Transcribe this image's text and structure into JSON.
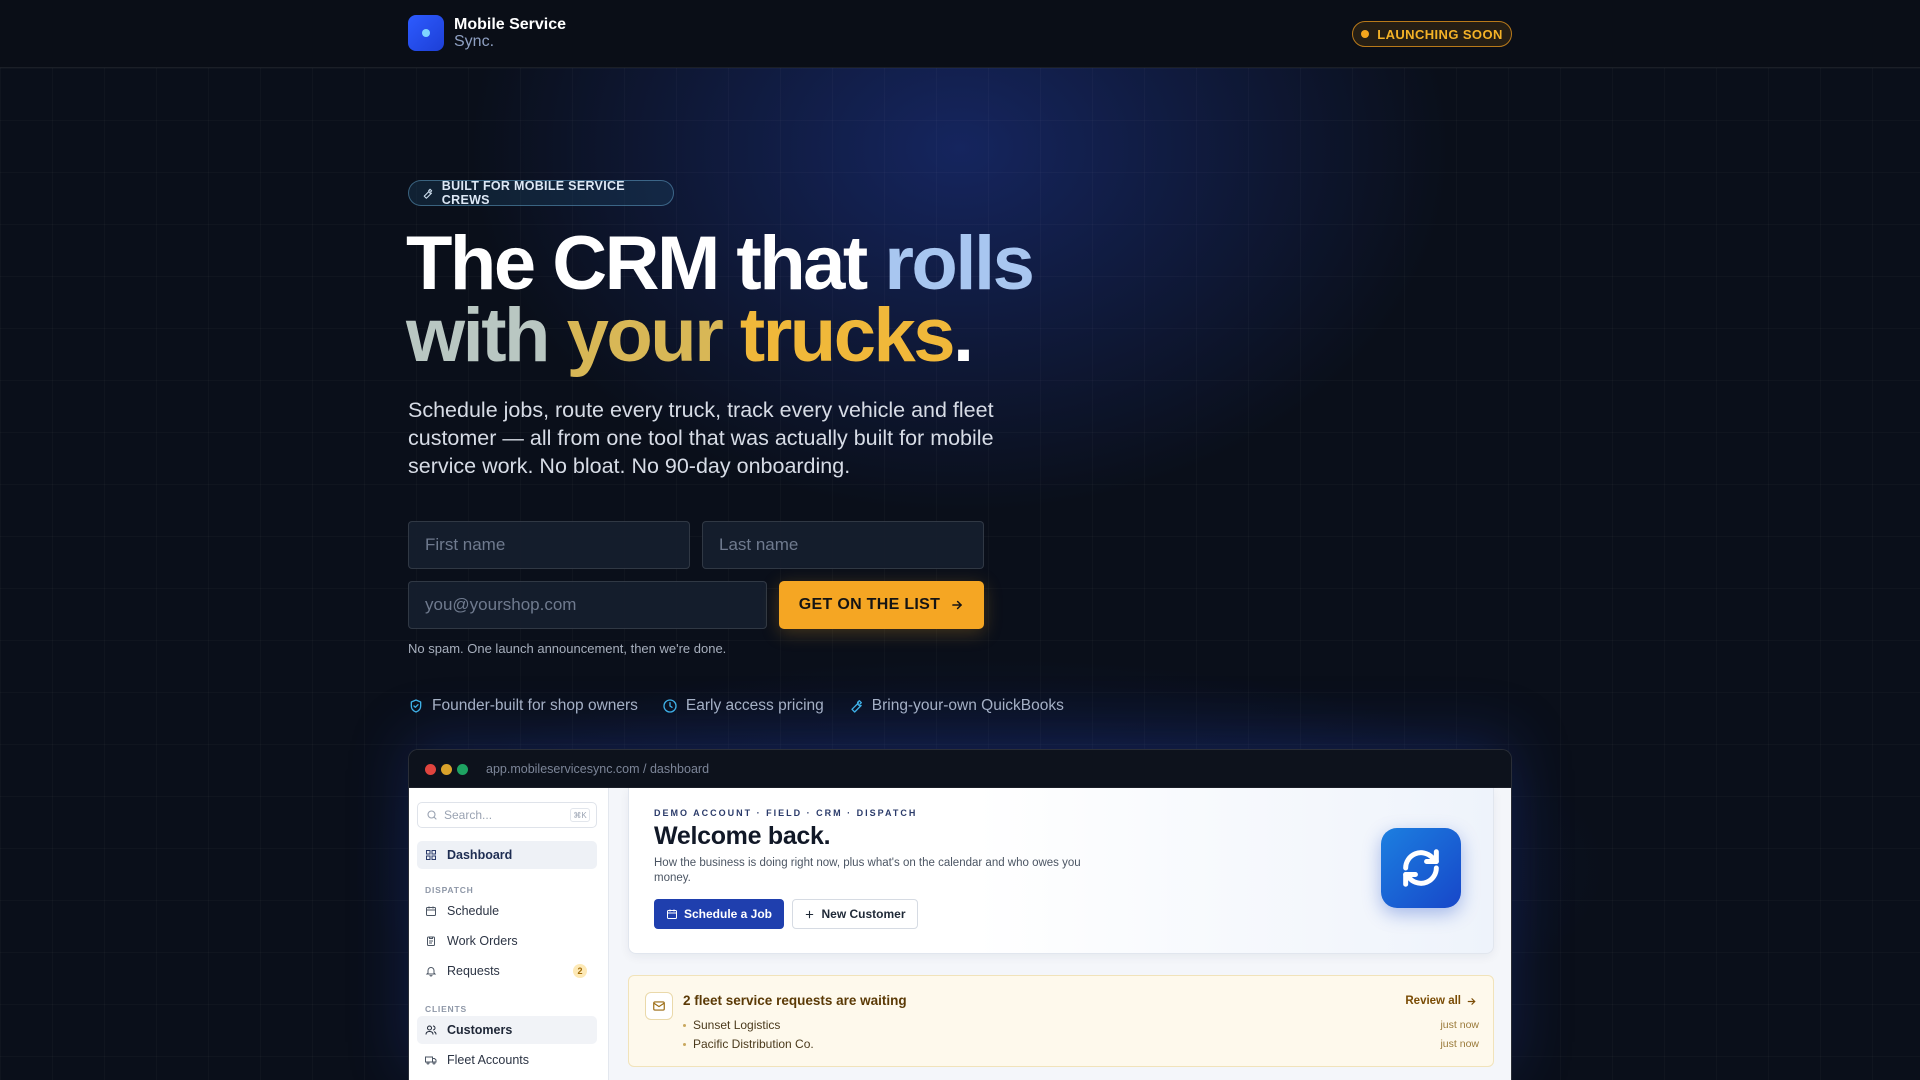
{
  "header": {
    "brand_name": "Mobile Service",
    "brand_sub": "Sync.",
    "launch_badge": "LAUNCHING SOON"
  },
  "hero": {
    "pill": "BUILT FOR MOBILE SERVICE CREWS",
    "headline": {
      "part1": "The CRM that ",
      "part2": "rolls",
      "part3": "with ",
      "part4": "your ",
      "part5": "trucks",
      "part6": "."
    },
    "subcopy": "Schedule jobs, route every truck, track every vehicle and fleet customer — all from one tool that was actually built for mobile service work. No bloat. No 90-day onboarding.",
    "form": {
      "first_name_placeholder": "First name",
      "last_name_placeholder": "Last name",
      "email_placeholder": "you@yourshop.com",
      "cta_label": "GET ON THE LIST",
      "disclaimer": "No spam. One launch announcement, then we're done."
    },
    "features": [
      {
        "label": "Founder-built for shop owners",
        "icon": "shield-check-icon"
      },
      {
        "label": "Early access pricing",
        "icon": "clock-icon"
      },
      {
        "label": "Bring-your-own QuickBooks",
        "icon": "wrench-icon"
      }
    ]
  },
  "preview": {
    "url": "app.mobileservicesync.com / dashboard",
    "traffic_lights": [
      "#e0443e",
      "#d9a22b",
      "#1ea362"
    ],
    "sidebar": {
      "search_placeholder": "Search...",
      "search_shortcut": "⌘K",
      "dashboard": "Dashboard",
      "section_dispatch": "DISPATCH",
      "schedule": "Schedule",
      "work_orders": "Work Orders",
      "requests": "Requests",
      "requests_count": "2",
      "section_clients": "CLIENTS",
      "customers": "Customers",
      "fleet_accounts": "Fleet Accounts"
    },
    "welcome": {
      "label": "DEMO ACCOUNT · FIELD · CRM · DISPATCH",
      "title": "Welcome back.",
      "subtitle": "How the business is doing right now, plus what's on the calendar and who owes you money.",
      "primary_button": "Schedule a Job",
      "secondary_button": "New Customer"
    },
    "alert": {
      "title": "2 fleet service requests are waiting",
      "review": "Review all",
      "rows": [
        {
          "name": "Sunset Logistics",
          "time": "just now"
        },
        {
          "name": "Pacific Distribution Co.",
          "time": "just now"
        }
      ]
    }
  },
  "colors": {
    "accent_orange": "#f5a623",
    "brand_blue": "#2d5bff",
    "headline_blue": "#a8c6f0",
    "headline_gold": "#f0b83a"
  }
}
